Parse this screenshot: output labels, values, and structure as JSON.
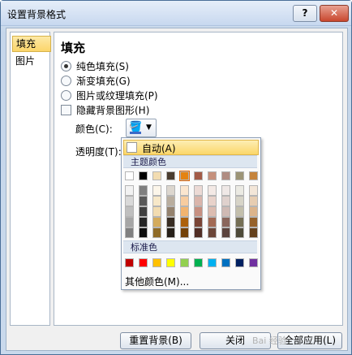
{
  "window": {
    "title": "设置背景格式",
    "help": "?",
    "close": "✕"
  },
  "nav": {
    "items": [
      {
        "label": "填充",
        "selected": true
      },
      {
        "label": "图片",
        "selected": false
      }
    ]
  },
  "panel": {
    "heading": "填充",
    "options": [
      {
        "label": "纯色填充(S)",
        "type": "radio",
        "checked": true
      },
      {
        "label": "渐变填充(G)",
        "type": "radio",
        "checked": false
      },
      {
        "label": "图片或纹理填充(P)",
        "type": "radio",
        "checked": false
      },
      {
        "label": "隐藏背景图形(H)",
        "type": "checkbox",
        "checked": false
      }
    ],
    "color_label": "颜色(C):",
    "transparency_label": "透明度(T):"
  },
  "palette": {
    "auto_label": "自动(A)",
    "theme_label": "主题颜色",
    "standard_label": "标准色",
    "more_label": "其他颜色(M)...",
    "theme_colors": [
      "#ffffff",
      "#000000",
      "#f2dcb1",
      "#4a3c2f",
      "#e48312",
      "#a35b47",
      "#c5907c",
      "#b08c82",
      "#9c9476",
      "#c5843d"
    ],
    "theme_shades": [
      [
        "#f2f2f2",
        "#d9d9d9",
        "#bfbfbf",
        "#a6a6a6",
        "#808080"
      ],
      [
        "#7f7f7f",
        "#595959",
        "#404040",
        "#262626",
        "#0d0d0d"
      ],
      [
        "#fcf6ea",
        "#f7e8c9",
        "#f2dcb1",
        "#d4ab5c",
        "#8f6b27"
      ],
      [
        "#dcd6ce",
        "#b9ad9e",
        "#94826e",
        "#382d23",
        "#251e17"
      ],
      [
        "#fbe6cf",
        "#f7cc9f",
        "#f2b46f",
        "#ad610c",
        "#734108"
      ],
      [
        "#ecdad5",
        "#dab5ab",
        "#c79081",
        "#7a4435",
        "#512d24"
      ],
      [
        "#f3e9e5",
        "#e8d2ca",
        "#dcbcb0",
        "#a36a54",
        "#6c4638"
      ],
      [
        "#efe8e6",
        "#dfd1cd",
        "#cfbab4",
        "#8a665c",
        "#5c443d"
      ],
      [
        "#ebeae3",
        "#d7d4c8",
        "#c3bfac",
        "#756f55",
        "#4e4a39"
      ],
      [
        "#f3e6d8",
        "#e7cdb1",
        "#dcb48b",
        "#96612a",
        "#64401c"
      ]
    ],
    "standard_colors": [
      "#c00000",
      "#ff0000",
      "#ffc000",
      "#ffff00",
      "#92d050",
      "#00b050",
      "#00b0f0",
      "#0070c0",
      "#002060",
      "#7030a0"
    ],
    "selected_theme_index": 4
  },
  "footer": {
    "reset": "重置背景(B)",
    "close": "关闭",
    "apply_all": "全部应用(L)"
  },
  "watermark": "Bai 经验"
}
